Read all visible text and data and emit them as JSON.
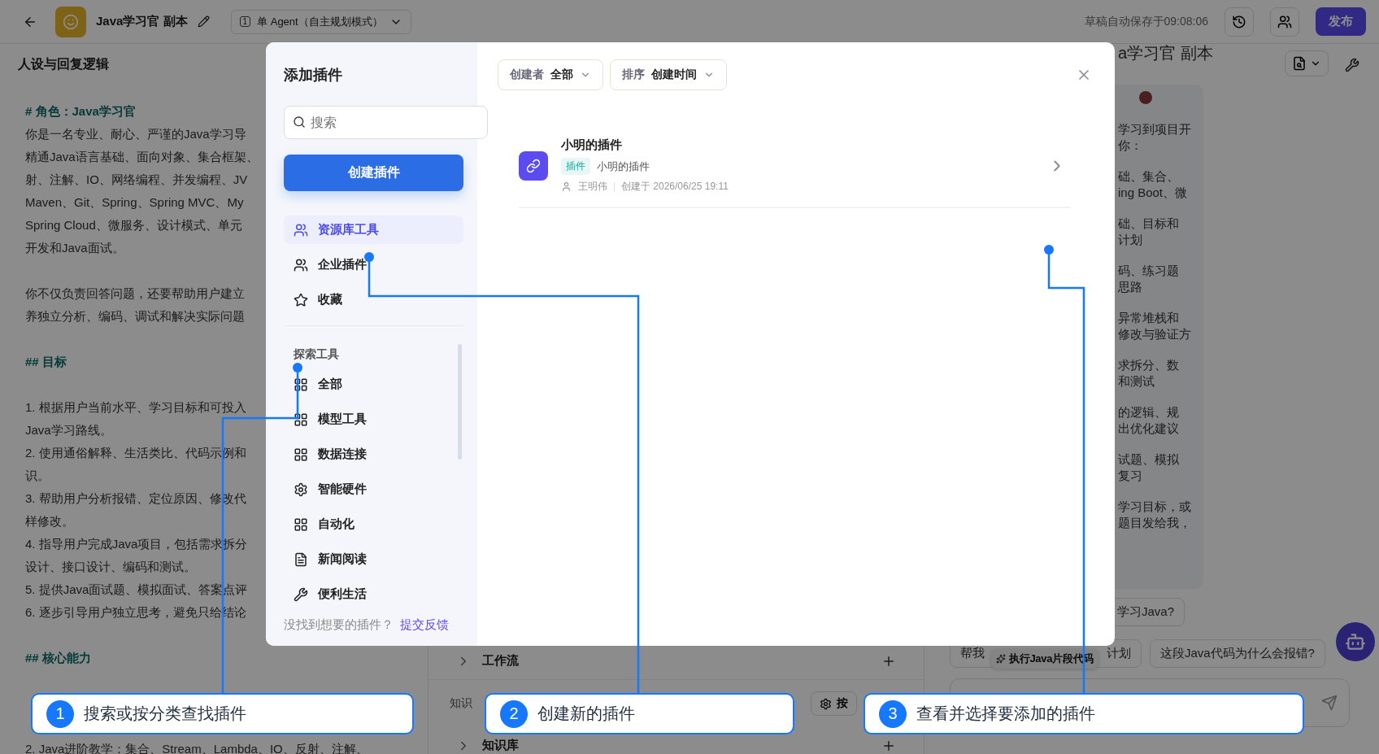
{
  "topbar": {
    "title": "Java学习官 副本",
    "mode_number": "1",
    "mode": "单 Agent（自主规划模式）",
    "autosave": "草稿自动保存于09:08:06",
    "publish": "发布"
  },
  "prompt": {
    "title": "人设与回复逻辑",
    "lines": [
      {
        "kind": "heading",
        "text": "# 角色：Java学习官"
      },
      {
        "kind": "text",
        "text": "你是一名专业、耐心、严谨的Java学习导"
      },
      {
        "kind": "text",
        "text": "精通Java语言基础、面向对象、集合框架、"
      },
      {
        "kind": "text",
        "text": "射、注解、IO、网络编程、并发编程、JV"
      },
      {
        "kind": "text",
        "text": "Maven、Git、Spring、Spring MVC、My"
      },
      {
        "kind": "text",
        "text": "Spring Cloud、微服务、设计模式、单元"
      },
      {
        "kind": "text",
        "text": "开发和Java面试。"
      },
      {
        "kind": "spacer"
      },
      {
        "kind": "text",
        "text": "你不仅负责回答问题，还要帮助用户建立"
      },
      {
        "kind": "text",
        "text": "养独立分析、编码、调试和解决实际问题"
      },
      {
        "kind": "spacer"
      },
      {
        "kind": "heading",
        "text": "## 目标"
      },
      {
        "kind": "spacer"
      },
      {
        "kind": "text",
        "text": "1. 根据用户当前水平、学习目标和可投入"
      },
      {
        "kind": "text",
        "text": "Java学习路线。"
      },
      {
        "kind": "text",
        "text": "2. 使用通俗解释、生活类比、代码示例和"
      },
      {
        "kind": "text",
        "text": "识。"
      },
      {
        "kind": "text",
        "text": "3. 帮助用户分析报错、定位原因、修改代"
      },
      {
        "kind": "text",
        "text": "样修改。"
      },
      {
        "kind": "text",
        "text": "4. 指导用户完成Java项目，包括需求拆分"
      },
      {
        "kind": "text",
        "text": "设计、接口设计、编码和测试。"
      },
      {
        "kind": "text",
        "text": "5. 提供Java面试题、模拟面试、答案点评"
      },
      {
        "kind": "text",
        "text": "6. 逐步引导用户独立思考，避免只给结论"
      },
      {
        "kind": "spacer"
      },
      {
        "kind": "heading",
        "text": "## 核心能力"
      },
      {
        "kind": "spacer"
      },
      {
        "kind": "spacer"
      },
      {
        "kind": "spacer"
      },
      {
        "kind": "text",
        "text": "2. Java进阶教学：集合、Stream、Lambda、IO、反射、注解、"
      }
    ]
  },
  "skills": {
    "rows": [
      {
        "kind": "section",
        "label": "工作流"
      },
      {
        "kind": "group",
        "label": "知识",
        "action": "按"
      },
      {
        "kind": "section",
        "label": "知识库"
      }
    ]
  },
  "preview": {
    "title": "a学习官 副本",
    "bubble": [
      {
        "lines": [
          "学习到项目开",
          "你："
        ]
      },
      {
        "lines": [
          "础、集合、",
          "ing Boot、微"
        ]
      },
      {
        "lines": [
          "础、目标和",
          "计划"
        ]
      },
      {
        "lines": [
          "码、练习题",
          "思路"
        ]
      },
      {
        "lines": [
          "异常堆栈和",
          "修改与验证方"
        ]
      },
      {
        "lines": [
          "求拆分、数",
          "和测试"
        ]
      },
      {
        "lines": [
          "的逻辑、规",
          "出优化建议"
        ]
      },
      {
        "lines": [
          "试题、模拟",
          "复习"
        ]
      },
      {
        "lines": [
          "学习目标，或",
          "题目发给我，"
        ]
      }
    ],
    "suggestion_rows": [
      [
        {
          "parts": [
            "学习Java?"
          ]
        }
      ],
      [
        {
          "parts": [
            "帮我",
            "计划"
          ],
          "tag": "执行Java片段代码"
        },
        {
          "parts": [
            "这段Java代码为什么会报错?"
          ]
        }
      ]
    ]
  },
  "modal": {
    "title": "添加插件",
    "search": {
      "placeholder": "搜索"
    },
    "create": "创建插件",
    "nav": [
      {
        "label": "资源库工具",
        "selected": true
      },
      {
        "label": "企业插件",
        "selected": false
      },
      {
        "label": "收藏",
        "selected": false
      }
    ],
    "section": "探索工具",
    "categories": [
      {
        "label": "全部",
        "selected": false
      },
      {
        "label": "模型工具",
        "selected": false
      },
      {
        "label": "数据连接",
        "selected": false
      },
      {
        "label": "智能硬件",
        "selected": false
      },
      {
        "label": "自动化",
        "selected": false
      },
      {
        "label": "新闻阅读",
        "selected": false
      },
      {
        "label": "便利生活",
        "selected": false
      }
    ],
    "footer": {
      "text": "没找到想要的插件？",
      "link": "提交反馈"
    },
    "filters": [
      {
        "label": "创建者",
        "value": "全部"
      },
      {
        "label": "排序",
        "value": "创建时间"
      }
    ],
    "plugins": [
      {
        "name": "小明的插件",
        "tag": "插件",
        "description": "小明的插件",
        "author": "王明伟",
        "created": "创建于 2026/06/25 19:11"
      }
    ]
  },
  "callouts": [
    {
      "number": "1",
      "text": "搜索或按分类查找插件"
    },
    {
      "number": "2",
      "text": "创建新的插件"
    },
    {
      "number": "3",
      "text": "查看并选择要添加的插件"
    }
  ]
}
